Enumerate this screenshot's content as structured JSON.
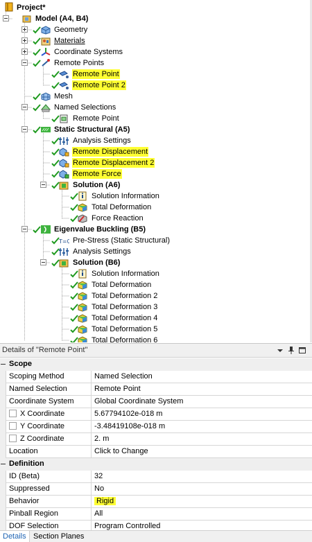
{
  "tree": {
    "nodes": [
      {
        "label": "Project*",
        "bold": true
      },
      {
        "label": "Model (A4, B4)",
        "bold": true
      },
      {
        "label": "Geometry"
      },
      {
        "label": "Materials",
        "underline": true
      },
      {
        "label": "Coordinate Systems"
      },
      {
        "label": "Remote Points"
      },
      {
        "label": "Remote Point",
        "highlight": true
      },
      {
        "label": "Remote Point 2",
        "highlight": true
      },
      {
        "label": "Mesh"
      },
      {
        "label": "Named Selections"
      },
      {
        "label": "Remote Point"
      },
      {
        "label": "Static Structural (A5)",
        "bold": true
      },
      {
        "label": "Analysis Settings"
      },
      {
        "label": "Remote Displacement",
        "highlight": true
      },
      {
        "label": "Remote Displacement 2",
        "highlight": true
      },
      {
        "label": "Remote Force",
        "highlight": true
      },
      {
        "label": "Solution (A6)",
        "bold": true
      },
      {
        "label": "Solution Information"
      },
      {
        "label": "Total Deformation"
      },
      {
        "label": "Force Reaction"
      },
      {
        "label": "Eigenvalue Buckling (B5)",
        "bold": true
      },
      {
        "label": "Pre-Stress (Static Structural)"
      },
      {
        "label": "Analysis Settings"
      },
      {
        "label": "Solution (B6)",
        "bold": true
      },
      {
        "label": "Solution Information"
      },
      {
        "label": "Total Deformation"
      },
      {
        "label": "Total Deformation 2"
      },
      {
        "label": "Total Deformation 3"
      },
      {
        "label": "Total Deformation 4"
      },
      {
        "label": "Total Deformation 5"
      },
      {
        "label": "Total Deformation 6"
      }
    ],
    "highlight_color": "#ffff33"
  },
  "details": {
    "title": "Details of \"Remote Point\"",
    "groups": [
      {
        "name": "Scope",
        "rows": [
          {
            "key": "Scoping Method",
            "value": "Named Selection"
          },
          {
            "key": "Named Selection",
            "value": "Remote Point"
          },
          {
            "key": "Coordinate System",
            "value": "Global Coordinate System"
          },
          {
            "key": "X Coordinate",
            "value": "5.67794102e-018 m",
            "checkbox": true
          },
          {
            "key": "Y Coordinate",
            "value": "-3.48419108e-018 m",
            "checkbox": true
          },
          {
            "key": "Z Coordinate",
            "value": "2. m",
            "checkbox": true
          },
          {
            "key": "Location",
            "value": "Click to Change"
          }
        ]
      },
      {
        "name": "Definition",
        "rows": [
          {
            "key": "ID (Beta)",
            "value": "32"
          },
          {
            "key": "Suppressed",
            "value": "No"
          },
          {
            "key": "Behavior",
            "value": "Rigid",
            "highlight": true
          },
          {
            "key": "Pinball Region",
            "value": "All"
          },
          {
            "key": "DOF Selection",
            "value": "Program Controlled"
          }
        ]
      }
    ]
  },
  "tabs": [
    {
      "label": "Details",
      "active": true
    },
    {
      "label": "Section Planes",
      "active": false
    }
  ]
}
